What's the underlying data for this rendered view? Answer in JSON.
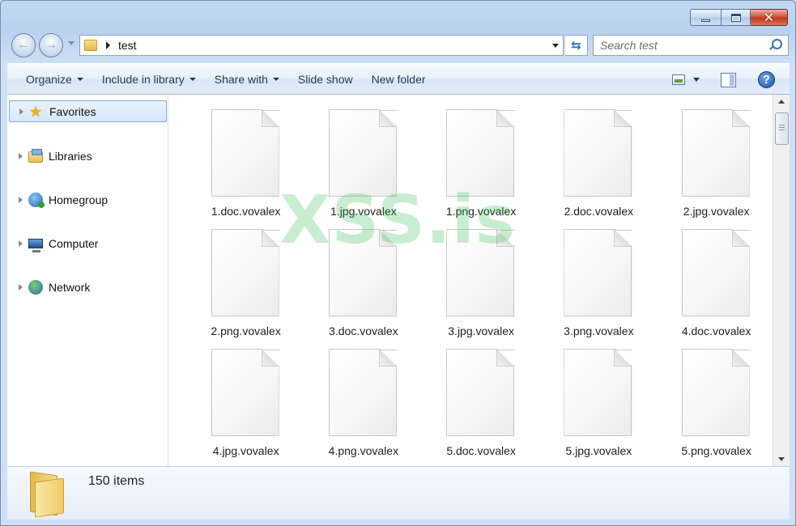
{
  "window": {
    "caption_buttons": [
      "minimize",
      "maximize",
      "close"
    ]
  },
  "address": {
    "path": "test"
  },
  "search": {
    "placeholder": "Search test"
  },
  "toolbar": {
    "organize": "Organize",
    "include_in_library": "Include in library",
    "share_with": "Share with",
    "slide_show": "Slide show",
    "new_folder": "New folder"
  },
  "navigation": {
    "items": [
      {
        "label": "Favorites",
        "icon": "star-icon",
        "selected": true
      },
      {
        "label": "Libraries",
        "icon": "libraries-icon"
      },
      {
        "label": "Homegroup",
        "icon": "homegroup-icon"
      },
      {
        "label": "Computer",
        "icon": "computer-icon"
      },
      {
        "label": "Network",
        "icon": "network-icon"
      }
    ]
  },
  "files": [
    "1.doc.vovalex",
    "1.jpg.vovalex",
    "1.png.vovalex",
    "2.doc.vovalex",
    "2.jpg.vovalex",
    "2.png.vovalex",
    "3.doc.vovalex",
    "3.jpg.vovalex",
    "3.png.vovalex",
    "4.doc.vovalex",
    "4.jpg.vovalex",
    "4.png.vovalex",
    "5.doc.vovalex",
    "5.jpg.vovalex",
    "5.png.vovalex"
  ],
  "watermark": "XSS.is",
  "details": {
    "item_count": "150 items"
  },
  "colors": {
    "accent": "#1e395b",
    "window_frame": "#b9d1ee",
    "close_button": "#c0391f",
    "watermark": "#3cbe5a"
  }
}
